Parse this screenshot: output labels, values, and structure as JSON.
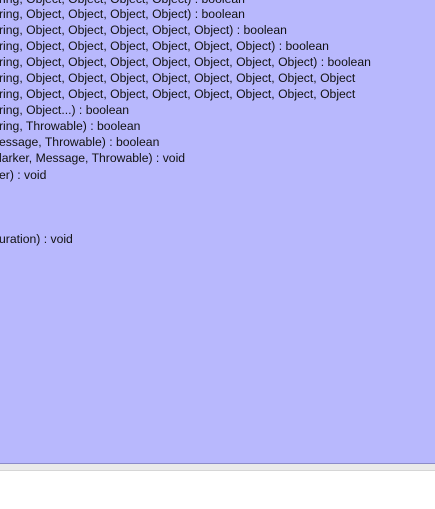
{
  "completion_popup": {
    "items": [
      "ring, Object, Object, Object, Object) : boolean",
      "ring, Object, Object, Object, Object, Object) : boolean",
      "ring, Object, Object, Object, Object, Object, Object) : boolean",
      "ring, Object, Object, Object, Object, Object, Object, Object) : boolean",
      "ring, Object, Object, Object, Object, Object, Object, Object, Object",
      "ring, Object, Object, Object, Object, Object, Object, Object, Object",
      "ring, Object...) : boolean",
      "ring, Throwable) : boolean",
      "essage, Throwable) : boolean",
      "larker, Message, Throwable) : void",
      "er) : void",
      "uration) : void"
    ]
  }
}
